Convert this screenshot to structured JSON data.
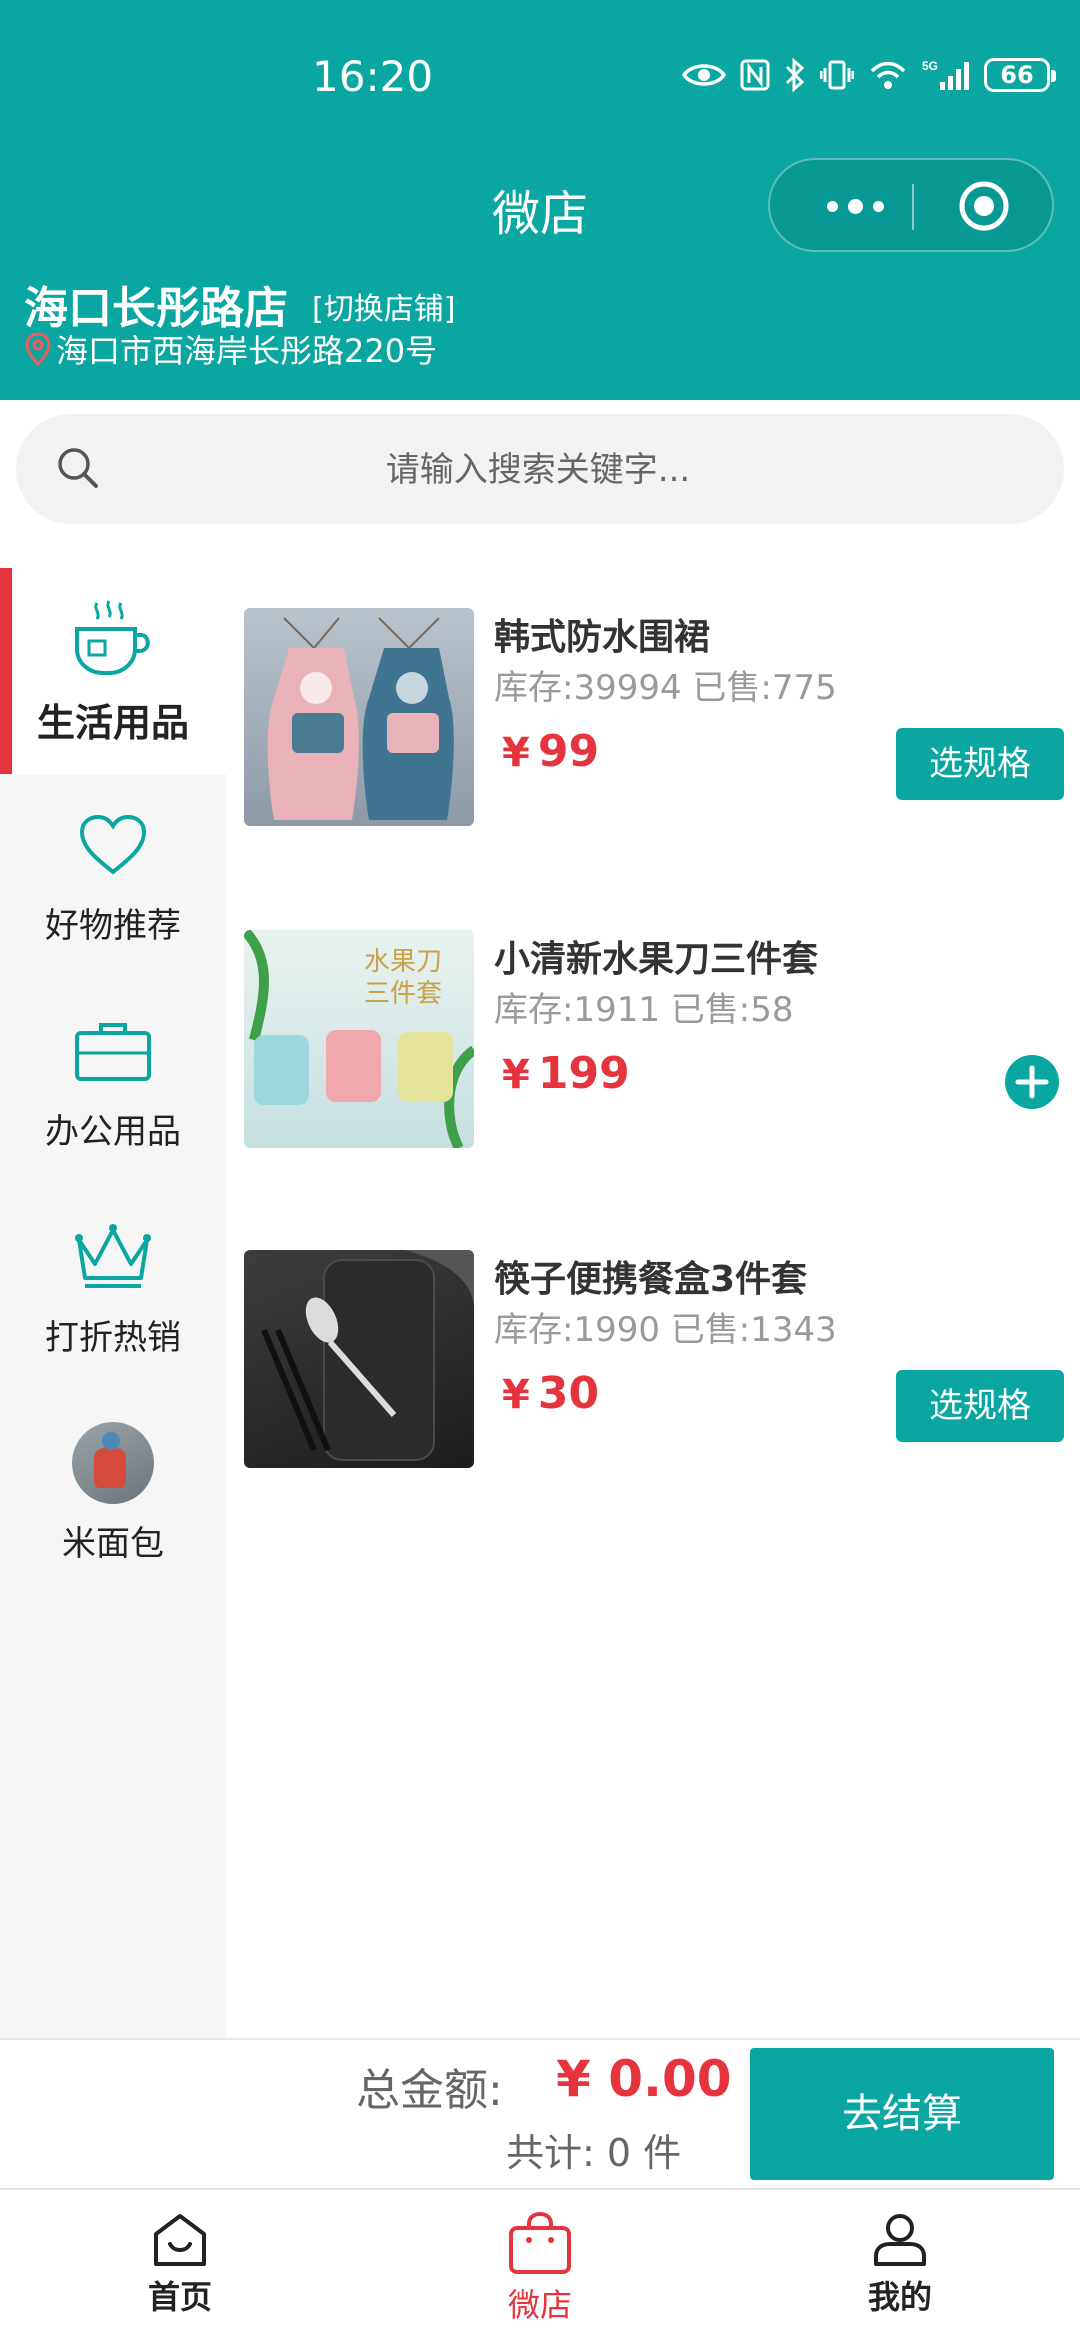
{
  "status_bar": {
    "time": "16:20",
    "battery": "66",
    "network": "5G"
  },
  "nav": {
    "title": "微店"
  },
  "store": {
    "name": "海口长彤路店",
    "switch_label": "[切换店铺]",
    "address": "海口市西海岸长彤路220号"
  },
  "search": {
    "placeholder": "请输入搜索关键字..."
  },
  "sidebar": {
    "items": [
      {
        "label": "生活用品",
        "icon": "cup-icon",
        "active": true
      },
      {
        "label": "好物推荐",
        "icon": "heart-icon",
        "active": false
      },
      {
        "label": "办公用品",
        "icon": "briefcase-icon",
        "active": false
      },
      {
        "label": "打折热销",
        "icon": "crown-icon",
        "active": false
      },
      {
        "label": "米面包",
        "icon": "avatar-image",
        "active": false
      }
    ]
  },
  "products": [
    {
      "name": "韩式防水围裙",
      "stock": "库存:39994 已售:775",
      "currency": "¥",
      "price": "99",
      "action": "选规格"
    },
    {
      "name": "小清新水果刀三件套",
      "stock": "库存:1911 已售:58",
      "currency": "¥",
      "price": "199",
      "action": "add-icon",
      "thumb_text": "水果刀\n三件套"
    },
    {
      "name": "筷子便携餐盒3件套",
      "stock": "库存:1990 已售:1343",
      "currency": "¥",
      "price": "30",
      "action": "选规格"
    }
  ],
  "cart": {
    "total_label": "总金额:",
    "total_amount": "¥ 0.00",
    "count_label": "共计:",
    "count_value": "0 件",
    "checkout_label": "去结算"
  },
  "tabbar": {
    "items": [
      {
        "label": "首页",
        "icon": "home-icon",
        "active": false
      },
      {
        "label": "微店",
        "icon": "shopping-bag-icon",
        "active": true
      },
      {
        "label": "我的",
        "icon": "user-icon",
        "active": false
      }
    ]
  },
  "colors": {
    "primary": "#0aa6a2",
    "accent": "#e6343f"
  }
}
